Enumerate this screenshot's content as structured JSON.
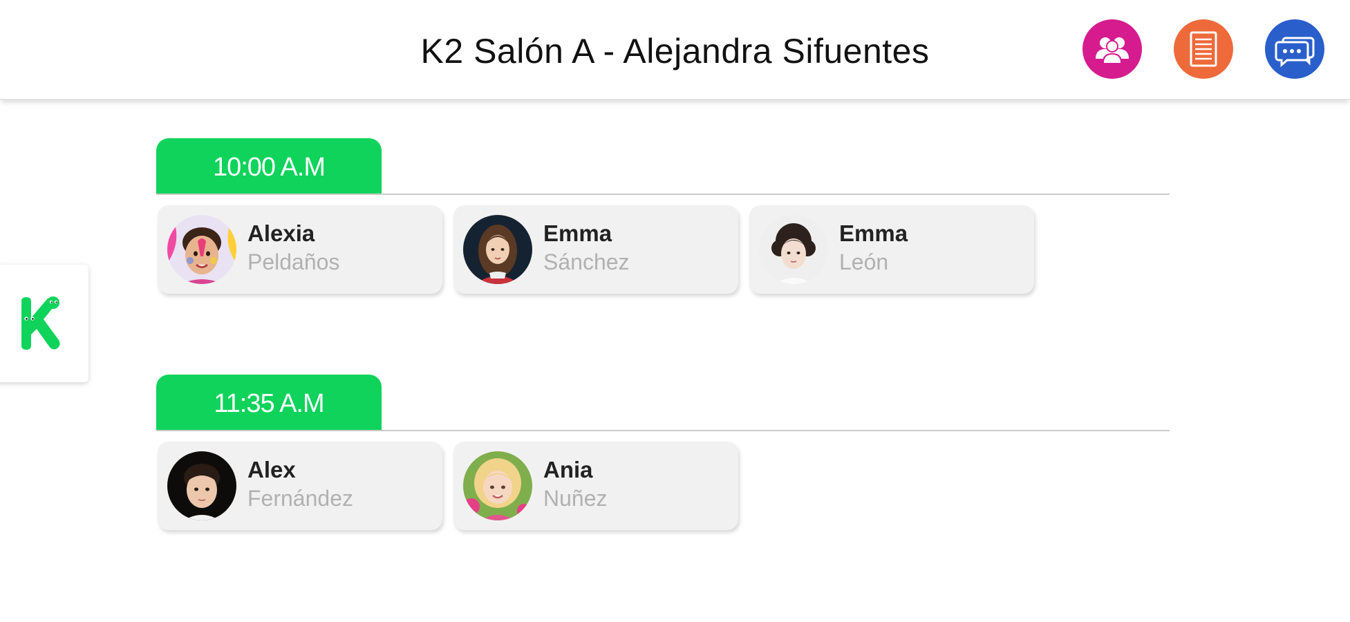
{
  "header": {
    "title": "K2 Salón A - Alejandra Sifuentes",
    "buttons": [
      {
        "icon": "group-icon",
        "color": "#d61b8f"
      },
      {
        "icon": "document-icon",
        "color": "#ee6a3a"
      },
      {
        "icon": "chat-icon",
        "color": "#2a5fcb"
      }
    ]
  },
  "side_tab": {
    "icon": "k-logo-icon",
    "color": "#0fd35b"
  },
  "accent_color": "#0fd35b",
  "groups": [
    {
      "time": "10:00 A.M",
      "students": [
        {
          "first": "Alexia",
          "last": "Peldaños"
        },
        {
          "first": "Emma",
          "last": "Sánchez"
        },
        {
          "first": "Emma",
          "last": "León"
        }
      ]
    },
    {
      "time": "11:35 A.M",
      "students": [
        {
          "first": "Alex",
          "last": "Fernández"
        },
        {
          "first": "Ania",
          "last": "Nuñez"
        }
      ]
    }
  ]
}
